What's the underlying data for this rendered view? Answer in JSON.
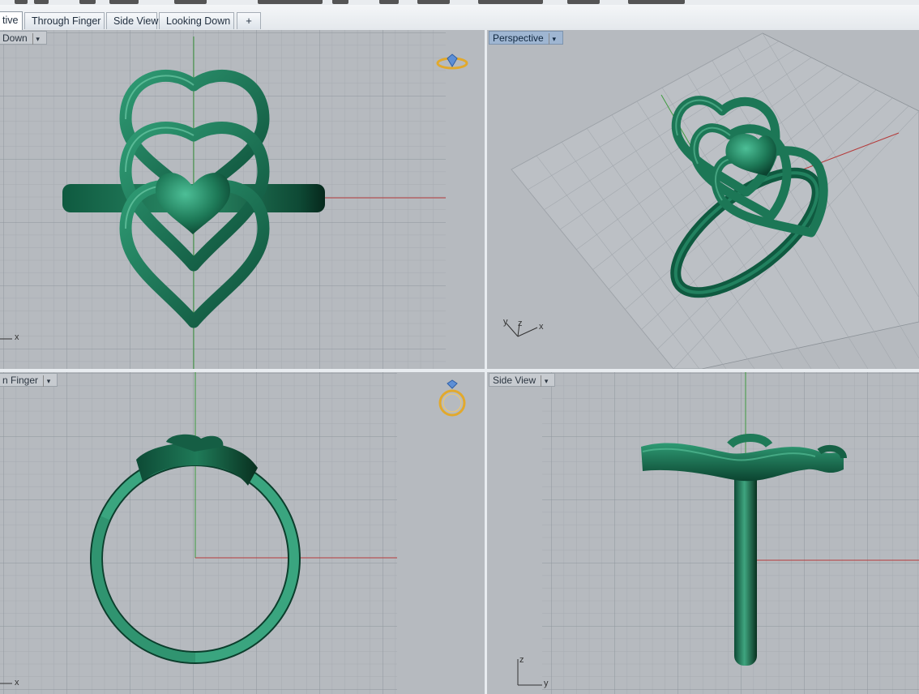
{
  "tabs": [
    {
      "label": "tive",
      "active": true
    },
    {
      "label": "Through Finger",
      "active": false
    },
    {
      "label": "Side View",
      "active": false
    },
    {
      "label": "Looking Down",
      "active": false
    }
  ],
  "add_tab_label": "+",
  "viewports": {
    "top_left": {
      "label": "Down",
      "axis": "x"
    },
    "top_right": {
      "label": "Perspective",
      "axis_y": "y",
      "axis_z": "z",
      "axis_x": "x"
    },
    "bottom_left": {
      "label": "n Finger",
      "axis": "x"
    },
    "bottom_right": {
      "label": "Side View",
      "axis_z": "z",
      "axis_y": "y"
    }
  },
  "colors": {
    "model": "#1f7a5a",
    "model_dark": "#0b4030",
    "model_light": "#3fb08a",
    "ring_inner": "#3aa57f",
    "axis_red": "#b23a3a",
    "axis_green": "#3a9a3a",
    "active_label": "#9fb6d2",
    "nav_icon": "#e2a92c"
  },
  "icons": [
    "dropdown-arrow-icon",
    "ring-nav-icon",
    "add-tab-icon"
  ]
}
